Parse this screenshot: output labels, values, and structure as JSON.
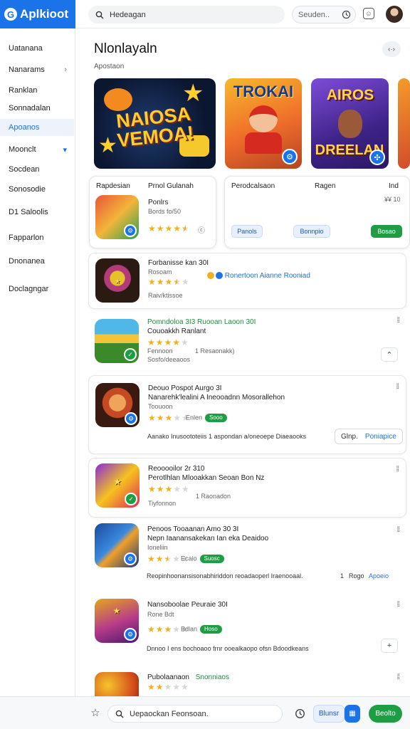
{
  "app": {
    "name": "Aplkioot",
    "logo_letter": "G"
  },
  "topbar": {
    "search_text": "Hedeagan",
    "field_text": "Seuden..",
    "clock_icon": "clock-icon",
    "chat_icon": "chat-icon"
  },
  "sidebar": {
    "items": [
      {
        "label": "Uatanana"
      },
      {
        "label": "Nanarams",
        "chevron": "›"
      },
      {
        "label": "Ranklan"
      },
      {
        "label": "Sonnadalan"
      },
      {
        "label": "Apoanos"
      },
      {
        "label": "Moonclt",
        "chevron": "▾"
      },
      {
        "label": "Socdean"
      },
      {
        "label": "Sonosodie"
      },
      {
        "label": "D1 Saloolis"
      },
      {
        "label": "Fapparlon"
      },
      {
        "label": "Dnonanea"
      },
      {
        "label": "Doclagngar"
      }
    ]
  },
  "page": {
    "title": "Nlonlayaln",
    "subtitle": "Apostaon",
    "action_icon": "‹·›"
  },
  "banners": [
    {
      "text": "NAIOSA VEMOA!"
    },
    {
      "text": "TROKAI"
    },
    {
      "text_top": "AIROS",
      "text_bottom": "DREELAN"
    }
  ],
  "detail_card_1": {
    "col1": "Rapdesian",
    "col2": "Prnol Gulanah",
    "name": "Ponlrs",
    "sub": "Bords fo/50",
    "rating": 4.5,
    "extra": "ⓒ"
  },
  "detail_card_2": {
    "col1": "Perodcalsaon",
    "col2": "Ragen",
    "col3": "Ind",
    "small": "¥¥ 10",
    "tags": [
      "Panols",
      "Bonnpio",
      "Bosao"
    ]
  },
  "list": [
    {
      "title": "Forbanisse kan 30I",
      "sub": "Rosoam",
      "rating": 3.5,
      "link_text": "Ronertoon Aianne Rooniad",
      "tail": "Raiv/ktissoe"
    },
    {
      "title": "Pomndoloa 3I3  Ruooan Laoon 30I",
      "line2": "Couoakkh Ranlant",
      "rating": 4,
      "sub": "Fennoon",
      "count_text": "1  Resaonakk)",
      "sub2": "Sosfo/deeaoos",
      "button": "⌃"
    },
    {
      "title": "Deouo  Pospot Aurgo 3I",
      "line2": "Nanarehk'lealini A Ineooadnn Mosorallehon",
      "sub": "Toouoon",
      "rating": 3,
      "pill": "Sooo",
      "pill_prefix": "Enlen",
      "desc": "Aanako Inusoototeiis 1 aspondan a/oneoepe Diaeaooks",
      "btn_left": "Glnp.",
      "btn_right": "Poniapice"
    },
    {
      "title": "Reooooilor  2r 310",
      "line2": "Perotlhlan Mlooakkan Seoan  Bon  Nz",
      "rating": 3,
      "count_text": "1  Raonadon",
      "sub": "Tiyfonnon"
    },
    {
      "title": "Penoos  Tooaanan Amo 30 3I",
      "line2": "Nepn Iaanansakekan Ian eka Deaidoo",
      "sub": "Ioneliin",
      "rating": 2.5,
      "pill_prefix": "Ecaio",
      "pill": "Suosc",
      "desc": "Reopinhoonansisonabhiriddon reoadaoperl Iraenooaal.",
      "tail_1": "1",
      "tail_2": "Rogo",
      "link_text": "Apoeio"
    },
    {
      "title": "Nansoboolae  Peuraie 30I",
      "sub": "Rone Bdt",
      "rating": 3,
      "pill_prefix": "Bdlan",
      "pill": "Hoso",
      "desc": "Dnnoo I ens bochoaoo frnr ooealkaopo ofsn Bdoodkeans",
      "button": "+"
    },
    {
      "title": "Pubolaanaon",
      "title_green": "Snonniaos",
      "rating": 2
    }
  ],
  "bottombar": {
    "search_text": "Uepaockan Feonsoan.",
    "tag_text": "Blunsr",
    "primary_text": "Beolto"
  },
  "colors": {
    "accent": "#1a73e8",
    "green": "#1e9e44",
    "star": "#f2b01e"
  }
}
